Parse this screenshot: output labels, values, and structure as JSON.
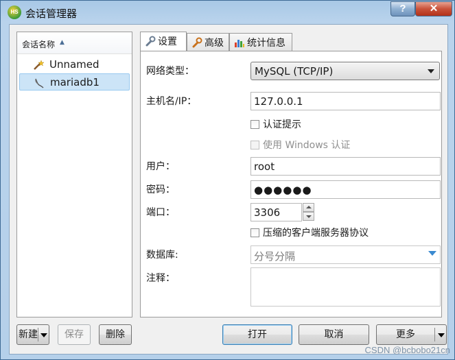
{
  "window": {
    "title": "会话管理器",
    "app_icon_text": "HS"
  },
  "titlebar": {
    "help_label": "?",
    "close_label": "✕"
  },
  "session_list": {
    "column_header": "会话名称",
    "sort_indicator": "▲",
    "items": [
      {
        "label": "Unnamed",
        "icon": "magic-wand-icon",
        "selected": false
      },
      {
        "label": "mariadb1",
        "icon": "mariadb-seal-icon",
        "selected": true
      }
    ]
  },
  "tabs": [
    {
      "label": "设置",
      "icon": "wrench-icon",
      "active": true
    },
    {
      "label": "高级",
      "icon": "wrench-orange-icon",
      "active": false
    },
    {
      "label": "统计信息",
      "icon": "bar-chart-icon",
      "active": false
    }
  ],
  "settings": {
    "network_type": {
      "label": "网络类型：",
      "value": "MySQL (TCP/IP)"
    },
    "host": {
      "label": "主机名/IP：",
      "value": "127.0.0.1"
    },
    "auth_prompt": {
      "label": "认证提示",
      "checked": false
    },
    "windows_auth": {
      "label": "使用 Windows 认证",
      "checked": false,
      "enabled": false
    },
    "user": {
      "label": "用户：",
      "value": "root"
    },
    "password": {
      "label": "密码：",
      "value": "●●●●●●"
    },
    "port": {
      "label": "端口：",
      "value": "3306"
    },
    "compress": {
      "label": "压缩的客户端服务器协议",
      "checked": false
    },
    "database": {
      "label": "数据库:",
      "placeholder": "分号分隔"
    },
    "comment": {
      "label": "注释：",
      "value": ""
    }
  },
  "buttons": {
    "new": "新建",
    "save": "保存",
    "delete": "删除",
    "open": "打开",
    "cancel": "取消",
    "more": "更多"
  },
  "watermark": "CSDN @bcbobo21cn",
  "colors": {
    "selection": "#cce4f7",
    "accent": "#3c7fb1",
    "close_red": "#c9523a"
  }
}
